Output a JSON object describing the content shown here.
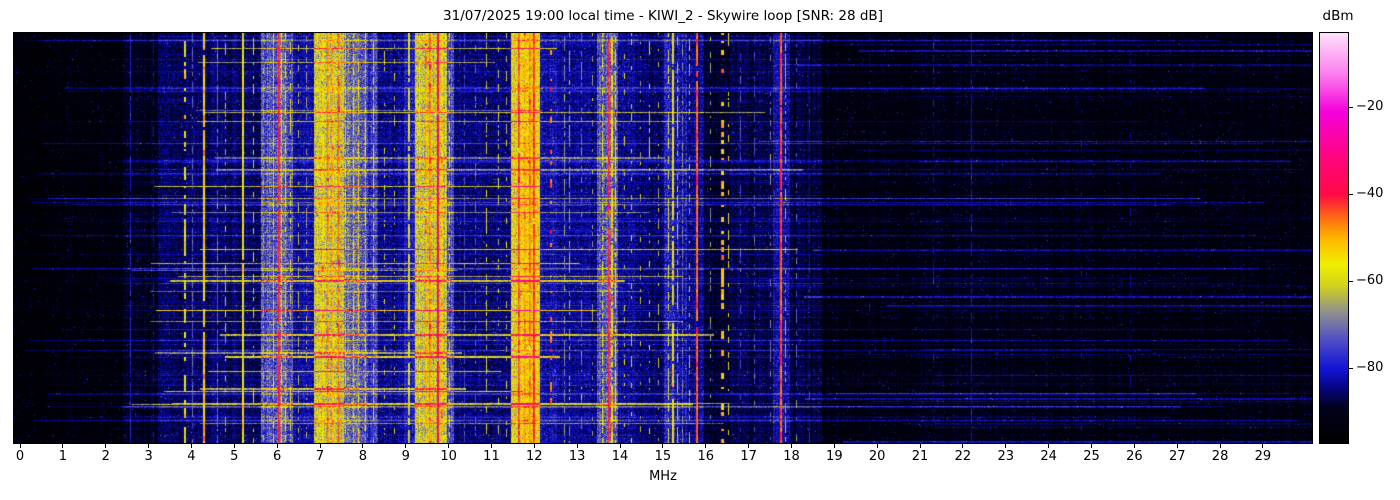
{
  "title": {
    "text": "31/07/2025 19:00 local time - KIWI_2 - Skywire loop [SNR: 28 dB]"
  },
  "x_axis": {
    "label": "MHz",
    "tick_labels": [
      "0",
      "1",
      "2",
      "3",
      "4",
      "5",
      "6",
      "7",
      "8",
      "9",
      "10",
      "11",
      "12",
      "13",
      "14",
      "15",
      "16",
      "17",
      "18",
      "19",
      "20",
      "21",
      "22",
      "23",
      "24",
      "25",
      "26",
      "27",
      "28",
      "29"
    ],
    "tick_values": [
      0,
      1,
      2,
      3,
      4,
      5,
      6,
      7,
      8,
      9,
      10,
      11,
      12,
      13,
      14,
      15,
      16,
      17,
      18,
      19,
      20,
      21,
      22,
      23,
      24,
      25,
      26,
      27,
      28,
      29
    ]
  },
  "colorbar": {
    "label": "dBm",
    "tick_labels": [
      "−20",
      "−40",
      "−60",
      "−80"
    ],
    "tick_values": [
      -20,
      -40,
      -60,
      -80
    ],
    "vmax": -3,
    "vmin": -97
  },
  "chart_data": {
    "type": "heatmap",
    "title": "31/07/2025 19:00 local time - KIWI_2 - Skywire loop [SNR: 28 dB]",
    "xlabel": "MHz",
    "x_range_mhz": [
      -0.14,
      30.15
    ],
    "y_axis": "time (waterfall, no tick labels)",
    "value_unit": "dBm",
    "value_range": [
      -97,
      -3
    ],
    "legend_position": "right colorbar",
    "seed": 42,
    "colormap": [
      [
        -97,
        "#000000"
      ],
      [
        -89,
        "#01011c"
      ],
      [
        -84,
        "#06068c"
      ],
      [
        -80,
        "#1414d4"
      ],
      [
        -74,
        "#4a4ac8"
      ],
      [
        -67,
        "#90908f"
      ],
      [
        -61,
        "#d2d21e"
      ],
      [
        -56,
        "#f0f000"
      ],
      [
        -50,
        "#ffb400"
      ],
      [
        -45,
        "#ff6414"
      ],
      [
        -40,
        "#ff0a46"
      ],
      [
        -31,
        "#ff0582"
      ],
      [
        -21,
        "#f500dc"
      ],
      [
        -12,
        "#fb82ee"
      ],
      [
        -3,
        "#ffe1fb"
      ]
    ],
    "noise_segments": [
      [
        -0.2,
        0.6,
        -95,
        2.2
      ],
      [
        0.6,
        2.4,
        -94,
        2.6
      ],
      [
        2.4,
        3.2,
        -90,
        3.2
      ],
      [
        3.2,
        5.6,
        -86,
        4.2
      ],
      [
        5.6,
        6.35,
        -73,
        9
      ],
      [
        6.35,
        6.85,
        -83,
        5.5
      ],
      [
        6.85,
        7.55,
        -63,
        8.5
      ],
      [
        7.55,
        8.05,
        -71,
        9
      ],
      [
        8.05,
        8.35,
        -77,
        7
      ],
      [
        8.35,
        8.95,
        -84,
        5
      ],
      [
        8.95,
        9.2,
        -80,
        6
      ],
      [
        9.2,
        9.95,
        -62,
        9
      ],
      [
        9.95,
        10.12,
        -74,
        7
      ],
      [
        10.12,
        11.45,
        -85,
        4.5
      ],
      [
        11.45,
        12.12,
        -58,
        9
      ],
      [
        12.12,
        12.55,
        -82,
        6
      ],
      [
        12.55,
        13.45,
        -84,
        5
      ],
      [
        13.45,
        13.95,
        -73,
        9
      ],
      [
        13.95,
        14.4,
        -84,
        5.5
      ],
      [
        14.4,
        15.02,
        -86,
        4.5
      ],
      [
        15.02,
        15.55,
        -80,
        7
      ],
      [
        15.55,
        15.95,
        -84,
        6
      ],
      [
        15.95,
        16.55,
        -89,
        3.5
      ],
      [
        16.55,
        17.55,
        -87,
        3.5
      ],
      [
        17.55,
        17.95,
        -82,
        6
      ],
      [
        17.95,
        18.7,
        -88,
        3
      ],
      [
        18.7,
        21.0,
        -92.5,
        2.6
      ],
      [
        21.0,
        24.0,
        -91.5,
        2.8
      ],
      [
        24.0,
        30.2,
        -92.5,
        2.6
      ]
    ],
    "carriers": [
      [
        2.57,
        1,
        -79,
        0.85
      ],
      [
        3.1,
        1,
        -82,
        0.5
      ],
      [
        3.83,
        2,
        -57,
        0.5
      ],
      [
        4.02,
        1,
        -72,
        0.7
      ],
      [
        4.27,
        2,
        -52,
        0.97
      ],
      [
        4.6,
        1,
        -72,
        0.7
      ],
      [
        4.78,
        1,
        -64,
        0.4
      ],
      [
        5.18,
        2,
        -56,
        0.97
      ],
      [
        5.44,
        1,
        -60,
        0.45
      ],
      [
        5.68,
        1,
        -64,
        0.4
      ],
      [
        5.9,
        1,
        -55,
        0.7
      ],
      [
        6.02,
        2,
        -40,
        0.97
      ],
      [
        6.1,
        1,
        -52,
        0.8
      ],
      [
        6.18,
        1,
        -58,
        0.6
      ],
      [
        6.3,
        1,
        -60,
        0.5
      ],
      [
        6.48,
        1,
        -64,
        0.4
      ],
      [
        6.68,
        1,
        -66,
        0.4
      ],
      [
        6.92,
        1,
        -56,
        0.7
      ],
      [
        7.05,
        2,
        -52,
        0.8
      ],
      [
        7.16,
        2,
        -47,
        0.85
      ],
      [
        7.28,
        2,
        -50,
        0.8
      ],
      [
        7.42,
        2,
        -46,
        0.9
      ],
      [
        7.58,
        1,
        -55,
        0.6
      ],
      [
        7.76,
        1,
        -56,
        0.6
      ],
      [
        7.88,
        1,
        -54,
        0.6
      ],
      [
        8.04,
        1,
        -56,
        0.5
      ],
      [
        8.24,
        1,
        -55,
        0.6
      ],
      [
        8.5,
        1,
        -62,
        0.35
      ],
      [
        8.72,
        1,
        -64,
        0.3
      ],
      [
        9.05,
        2,
        -58,
        0.8
      ],
      [
        9.3,
        1,
        -56,
        0.6
      ],
      [
        9.45,
        2,
        -50,
        0.85
      ],
      [
        9.55,
        2,
        -46,
        0.9
      ],
      [
        9.72,
        2,
        -37,
        0.97
      ],
      [
        9.82,
        2,
        -52,
        0.8
      ],
      [
        9.92,
        1,
        -55,
        0.7
      ],
      [
        10.02,
        1,
        -60,
        0.5
      ],
      [
        10.35,
        1,
        -75,
        0.6
      ],
      [
        10.62,
        1,
        -73,
        0.5
      ],
      [
        10.88,
        1,
        -62,
        0.5
      ],
      [
        11.15,
        1,
        -62,
        0.35
      ],
      [
        11.33,
        1,
        -63,
        0.35
      ],
      [
        11.63,
        2,
        -43,
        0.95
      ],
      [
        11.76,
        2,
        -49,
        0.9
      ],
      [
        11.87,
        2,
        -46,
        0.9
      ],
      [
        11.96,
        2,
        -41,
        0.95
      ],
      [
        12.06,
        1,
        -54,
        0.8
      ],
      [
        12.36,
        2,
        -45,
        0.25
      ],
      [
        12.7,
        1,
        -68,
        0.6
      ],
      [
        12.8,
        1,
        -66,
        0.5
      ],
      [
        13.08,
        1,
        -70,
        0.4
      ],
      [
        13.35,
        1,
        -66,
        0.3
      ],
      [
        13.58,
        1,
        -56,
        0.6
      ],
      [
        13.71,
        2,
        -40,
        0.95
      ],
      [
        13.8,
        2,
        -52,
        0.8
      ],
      [
        13.88,
        1,
        -56,
        0.7
      ],
      [
        14.1,
        1,
        -62,
        0.3
      ],
      [
        14.25,
        1,
        -61,
        0.3
      ],
      [
        14.47,
        1,
        -63,
        0.3
      ],
      [
        14.68,
        1,
        -62,
        0.3
      ],
      [
        14.88,
        1,
        -64,
        0.3
      ],
      [
        15.12,
        1,
        -60,
        0.6
      ],
      [
        15.21,
        2,
        -57,
        0.85
      ],
      [
        15.32,
        1,
        -61,
        0.6
      ],
      [
        15.45,
        1,
        -70,
        0.6
      ],
      [
        15.62,
        1,
        -64,
        0.4
      ],
      [
        15.78,
        2,
        -44,
        0.98
      ],
      [
        16.1,
        1,
        -66,
        0.25
      ],
      [
        16.36,
        3,
        -49,
        0.45
      ],
      [
        16.52,
        1,
        -58,
        0.3
      ],
      [
        16.8,
        1,
        -75,
        0.4
      ],
      [
        17.12,
        1,
        -76,
        0.4
      ],
      [
        17.5,
        1,
        -70,
        0.4
      ],
      [
        17.74,
        2,
        -43,
        0.96
      ],
      [
        17.86,
        1,
        -63,
        0.5
      ],
      [
        18.1,
        1,
        -72,
        0.3
      ],
      [
        18.4,
        1,
        -80,
        0.4
      ],
      [
        19.8,
        1,
        -87,
        0.5
      ],
      [
        21.3,
        1,
        -83,
        0.45
      ],
      [
        22.2,
        1,
        -81,
        0.8
      ],
      [
        24.75,
        1,
        -88,
        0.5
      ],
      [
        25.9,
        1,
        -84,
        0.3
      ],
      [
        27.5,
        1,
        -89,
        0.4
      ]
    ],
    "streaks": {
      "strong": {
        "count": 26,
        "f0": [
          2.3,
          4.9
        ],
        "f1": [
          9.5,
          18.3
        ],
        "boost": [
          13,
          26
        ]
      },
      "wide": {
        "count": 34,
        "f0": [
          0.0,
          2.5
        ],
        "f1": [
          26.0,
          30.2
        ],
        "boost": [
          3.5,
          9.0
        ]
      },
      "right": {
        "count": 26,
        "f0": [
          17.0,
          21.5
        ],
        "f1": [
          30.2,
          30.2
        ],
        "boost": [
          4,
          11
        ]
      }
    }
  }
}
